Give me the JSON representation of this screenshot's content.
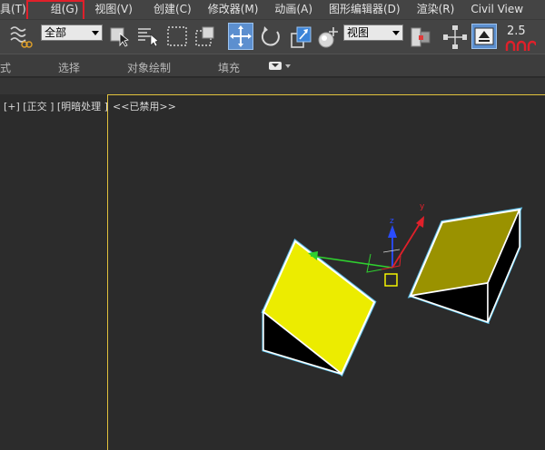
{
  "menu": {
    "items": [
      "具(T)",
      "组(G)",
      "视图(V)",
      "创建(C)",
      "修改器(M)",
      "动画(A)",
      "图形编辑器(D)",
      "渲染(R)",
      "Civil View"
    ]
  },
  "toolbar": {
    "selection_filter": "全部",
    "reference_coord": "视图",
    "snap_value": "2.5"
  },
  "ribbon": {
    "labels": [
      "式",
      "选择",
      "对象绘制",
      "填充"
    ]
  },
  "viewports": {
    "left_label": "[+] [正交 ] [明暗处理 ]",
    "main_label": "<<已禁用>>"
  },
  "gizmo": {
    "axis_z": "z",
    "axis_y": "y"
  },
  "colors": {
    "highlight": "#e0202a",
    "viewport_border": "#e2c23c",
    "box_yellow": "#ecec00",
    "box_olive": "#9a9200",
    "selection_outline": "#5fd0ff"
  }
}
